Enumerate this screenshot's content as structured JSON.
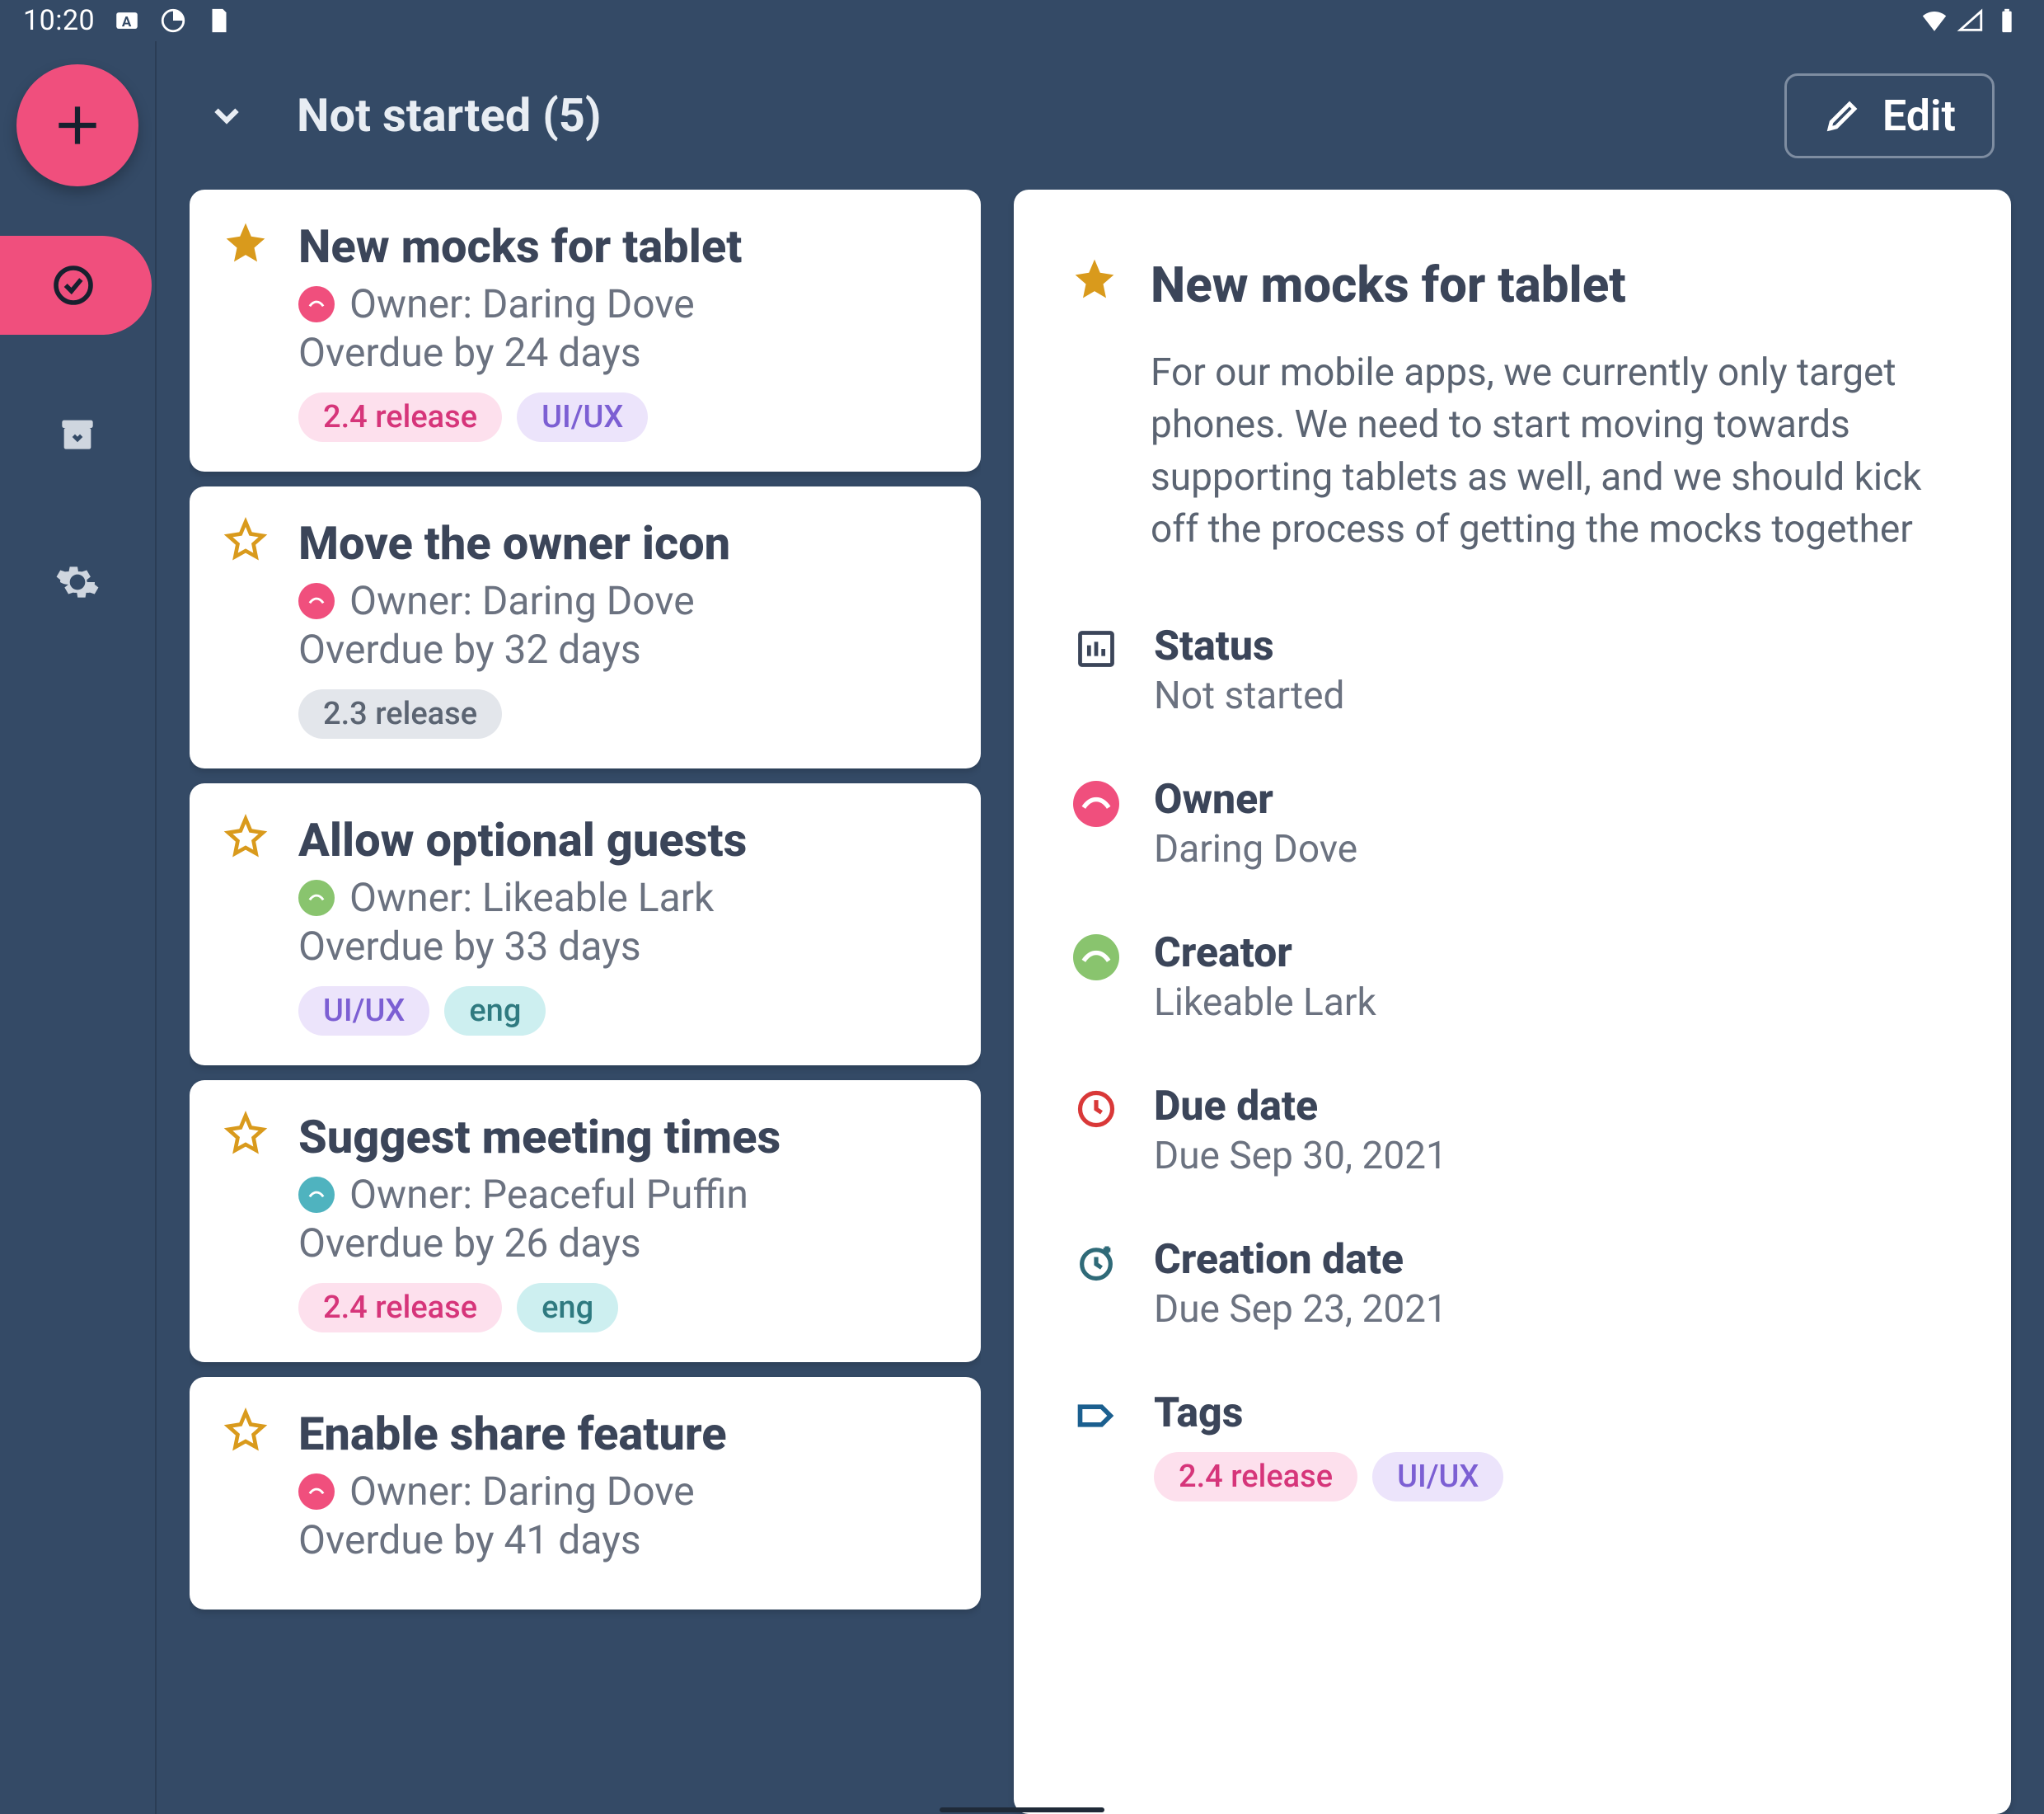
{
  "statusbar": {
    "time": "10:20"
  },
  "section": {
    "title": "Not started (5)",
    "edit_label": "Edit"
  },
  "tasks": [
    {
      "starred": true,
      "title": "New mocks for tablet",
      "owner_label": "Owner: Daring Dove",
      "owner_color": "pink",
      "overdue": "Overdue by 24 days",
      "tags": [
        {
          "label": "2.4 release",
          "color": "pink"
        },
        {
          "label": "UI/UX",
          "color": "purple"
        }
      ]
    },
    {
      "starred": false,
      "title": "Move the owner icon",
      "owner_label": "Owner: Daring Dove",
      "owner_color": "pink",
      "overdue": "Overdue by 32 days",
      "tags": [
        {
          "label": "2.3 release",
          "color": "gray"
        }
      ]
    },
    {
      "starred": false,
      "title": "Allow optional guests",
      "owner_label": "Owner: Likeable Lark",
      "owner_color": "green",
      "overdue": "Overdue by 33 days",
      "tags": [
        {
          "label": "UI/UX",
          "color": "purple"
        },
        {
          "label": "eng",
          "color": "teal"
        }
      ]
    },
    {
      "starred": false,
      "title": "Suggest meeting times",
      "owner_label": "Owner: Peaceful Puffin",
      "owner_color": "teal",
      "overdue": "Overdue by 26 days",
      "tags": [
        {
          "label": "2.4 release",
          "color": "pink"
        },
        {
          "label": "eng",
          "color": "teal"
        }
      ]
    },
    {
      "starred": false,
      "title": "Enable share feature",
      "owner_label": "Owner: Daring Dove",
      "owner_color": "pink",
      "overdue": "Overdue by 41 days",
      "tags": []
    }
  ],
  "detail": {
    "title": "New mocks for tablet",
    "starred": true,
    "description": "For our mobile apps, we currently only target phones. We need to start moving towards supporting tablets as well, and we should kick off the process of getting the mocks together",
    "status": {
      "label": "Status",
      "value": "Not started"
    },
    "owner": {
      "label": "Owner",
      "value": "Daring Dove",
      "color": "pink"
    },
    "creator": {
      "label": "Creator",
      "value": "Likeable Lark",
      "color": "green"
    },
    "due_date": {
      "label": "Due date",
      "value": "Due Sep 30, 2021"
    },
    "creation_date": {
      "label": "Creation date",
      "value": "Due Sep 23, 2021"
    },
    "tags": {
      "label": "Tags",
      "items": [
        {
          "label": "2.4 release",
          "color": "pink"
        },
        {
          "label": "UI/UX",
          "color": "purple"
        }
      ]
    }
  }
}
